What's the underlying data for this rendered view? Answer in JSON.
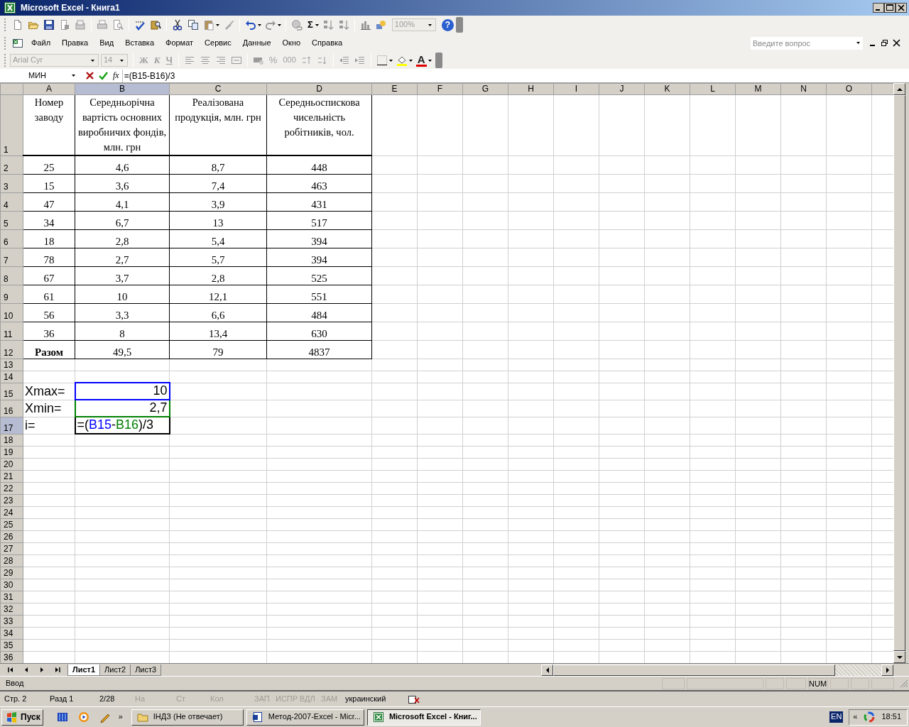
{
  "window": {
    "title": "Microsoft Excel - Книга1"
  },
  "standard_toolbar": {
    "sum": "Σ",
    "zoom": "100%",
    "help": "?"
  },
  "menu": [
    "Файл",
    "Правка",
    "Вид",
    "Вставка",
    "Формат",
    "Сервис",
    "Данные",
    "Окно",
    "Справка"
  ],
  "help_search": {
    "placeholder": "Введите вопрос"
  },
  "formatting_toolbar": {
    "disabled": true,
    "font": "Arial Cyr",
    "size": "14",
    "bold": "Ж",
    "italic": "К",
    "underline": "Ч",
    "percent": "%",
    "thousands": "000",
    "font_color": "A"
  },
  "formula_bar": {
    "name_box": "МИН",
    "fx": "fx",
    "content": "=(B15-B16)/3"
  },
  "columns": [
    {
      "label": "A",
      "selected": false
    },
    {
      "label": "B",
      "selected": true
    },
    {
      "label": "C",
      "selected": false
    },
    {
      "label": "D",
      "selected": false
    },
    {
      "label": "E",
      "selected": false
    },
    {
      "label": "F",
      "selected": false
    },
    {
      "label": "G",
      "selected": false
    },
    {
      "label": "H",
      "selected": false
    },
    {
      "label": "I",
      "selected": false
    },
    {
      "label": "J",
      "selected": false
    },
    {
      "label": "K",
      "selected": false
    },
    {
      "label": "L",
      "selected": false
    },
    {
      "label": "M",
      "selected": false
    },
    {
      "label": "N",
      "selected": false
    },
    {
      "label": "O",
      "selected": false
    }
  ],
  "rows": [
    {
      "label": "1",
      "selected": false,
      "kind": "header",
      "cells": [
        "Номер заводу",
        "Середньорічна вартість основних виробничих фондів, млн. грн",
        "Реалізована продукція, млн. грн",
        "Середньоспискова чисельність робітників, чол."
      ]
    },
    {
      "label": "2",
      "selected": false,
      "kind": "data",
      "cells": [
        "25",
        "4,6",
        "8,7",
        "448"
      ]
    },
    {
      "label": "3",
      "selected": false,
      "kind": "data",
      "cells": [
        "15",
        "3,6",
        "7,4",
        "463"
      ]
    },
    {
      "label": "4",
      "selected": false,
      "kind": "data",
      "cells": [
        "47",
        "4,1",
        "3,9",
        "431"
      ]
    },
    {
      "label": "5",
      "selected": false,
      "kind": "data",
      "cells": [
        "34",
        "6,7",
        "13",
        "517"
      ]
    },
    {
      "label": "6",
      "selected": false,
      "kind": "data",
      "cells": [
        "18",
        "2,8",
        "5,4",
        "394"
      ]
    },
    {
      "label": "7",
      "selected": false,
      "kind": "data",
      "cells": [
        "78",
        "2,7",
        "5,7",
        "394"
      ]
    },
    {
      "label": "8",
      "selected": false,
      "kind": "data",
      "cells": [
        "67",
        "3,7",
        "2,8",
        "525"
      ]
    },
    {
      "label": "9",
      "selected": false,
      "kind": "data",
      "cells": [
        "61",
        "10",
        "12,1",
        "551"
      ]
    },
    {
      "label": "10",
      "selected": false,
      "kind": "data",
      "cells": [
        "56",
        "3,3",
        "6,6",
        "484"
      ]
    },
    {
      "label": "11",
      "selected": false,
      "kind": "data",
      "cells": [
        "36",
        "8",
        "13,4",
        "630"
      ]
    },
    {
      "label": "12",
      "selected": false,
      "kind": "total",
      "cells": [
        "Разом",
        "49,5",
        "79",
        "4837"
      ]
    },
    {
      "label": "13",
      "selected": false,
      "kind": "empty",
      "cells": []
    },
    {
      "label": "14",
      "selected": false,
      "kind": "empty",
      "cells": []
    },
    {
      "label": "15",
      "selected": false,
      "kind": "calc",
      "cells": [
        {
          "text": "Xmax="
        },
        {
          "text": "10",
          "color": "#0000ff"
        }
      ]
    },
    {
      "label": "16",
      "selected": false,
      "kind": "calc",
      "cells": [
        {
          "text": "Xmin="
        },
        {
          "text": "2,7",
          "color": "#008000"
        }
      ]
    },
    {
      "label": "17",
      "selected": true,
      "kind": "calc",
      "cells": [
        {
          "text": "i="
        },
        {
          "formula": [
            {
              "text": "=(",
              "color": "#000000"
            },
            {
              "text": "B15",
              "color": "#0000ff"
            },
            {
              "text": "-",
              "color": "#000000"
            },
            {
              "text": "B16",
              "color": "#008000"
            },
            {
              "text": ")/3",
              "color": "#000000"
            }
          ]
        }
      ]
    },
    {
      "label": "18",
      "selected": false,
      "kind": "empty",
      "cells": []
    },
    {
      "label": "19",
      "selected": false,
      "kind": "empty",
      "cells": []
    },
    {
      "label": "20",
      "selected": false,
      "kind": "empty",
      "cells": []
    },
    {
      "label": "21",
      "selected": false,
      "kind": "empty",
      "cells": []
    },
    {
      "label": "22",
      "selected": false,
      "kind": "empty",
      "cells": []
    },
    {
      "label": "23",
      "selected": false,
      "kind": "empty",
      "cells": []
    },
    {
      "label": "24",
      "selected": false,
      "kind": "empty",
      "cells": []
    },
    {
      "label": "25",
      "selected": false,
      "kind": "empty",
      "cells": []
    },
    {
      "label": "26",
      "selected": false,
      "kind": "empty",
      "cells": []
    },
    {
      "label": "27",
      "selected": false,
      "kind": "empty",
      "cells": []
    },
    {
      "label": "28",
      "selected": false,
      "kind": "empty",
      "cells": []
    },
    {
      "label": "29",
      "selected": false,
      "kind": "empty",
      "cells": []
    },
    {
      "label": "30",
      "selected": false,
      "kind": "empty",
      "cells": []
    },
    {
      "label": "31",
      "selected": false,
      "kind": "empty",
      "cells": []
    },
    {
      "label": "32",
      "selected": false,
      "kind": "empty",
      "cells": []
    },
    {
      "label": "33",
      "selected": false,
      "kind": "empty",
      "cells": []
    },
    {
      "label": "34",
      "selected": false,
      "kind": "empty",
      "cells": []
    },
    {
      "label": "35",
      "selected": false,
      "kind": "empty",
      "cells": []
    },
    {
      "label": "36",
      "selected": false,
      "kind": "empty",
      "cells": []
    }
  ],
  "sheet_tabs": [
    {
      "label": "Лист1",
      "selected": true
    },
    {
      "label": "Лист2",
      "selected": false
    },
    {
      "label": "Лист3",
      "selected": false
    }
  ],
  "status_bar": {
    "mode": "Ввод",
    "num_lock": "NUM"
  },
  "word_status_bar": [
    {
      "text": "Стр. 2",
      "disabled": false
    },
    {
      "text": "Разд 1",
      "disabled": false
    },
    {
      "text": "2/28",
      "disabled": false
    },
    {
      "text": "На",
      "disabled": true
    },
    {
      "text": "Ст",
      "disabled": true
    },
    {
      "text": "Кол",
      "disabled": true
    },
    {
      "text": "ЗАП",
      "disabled": true
    },
    {
      "text": "ИСПР",
      "disabled": true
    },
    {
      "text": "ВДЛ",
      "disabled": true
    },
    {
      "text": "ЗАМ",
      "disabled": true
    },
    {
      "text": "украинский",
      "disabled": false
    }
  ],
  "taskbar": {
    "start": "Пуск",
    "more": "»",
    "tasks": [
      {
        "label": "ІНДЗ (Не отвечает)",
        "selected": false
      },
      {
        "label": "Метод-2007-Excel - Micr...",
        "selected": false
      },
      {
        "label": "Microsoft Excel - Книг...",
        "selected": true
      }
    ],
    "language": "EN",
    "tray_expand": "«",
    "clock": "18:51"
  }
}
